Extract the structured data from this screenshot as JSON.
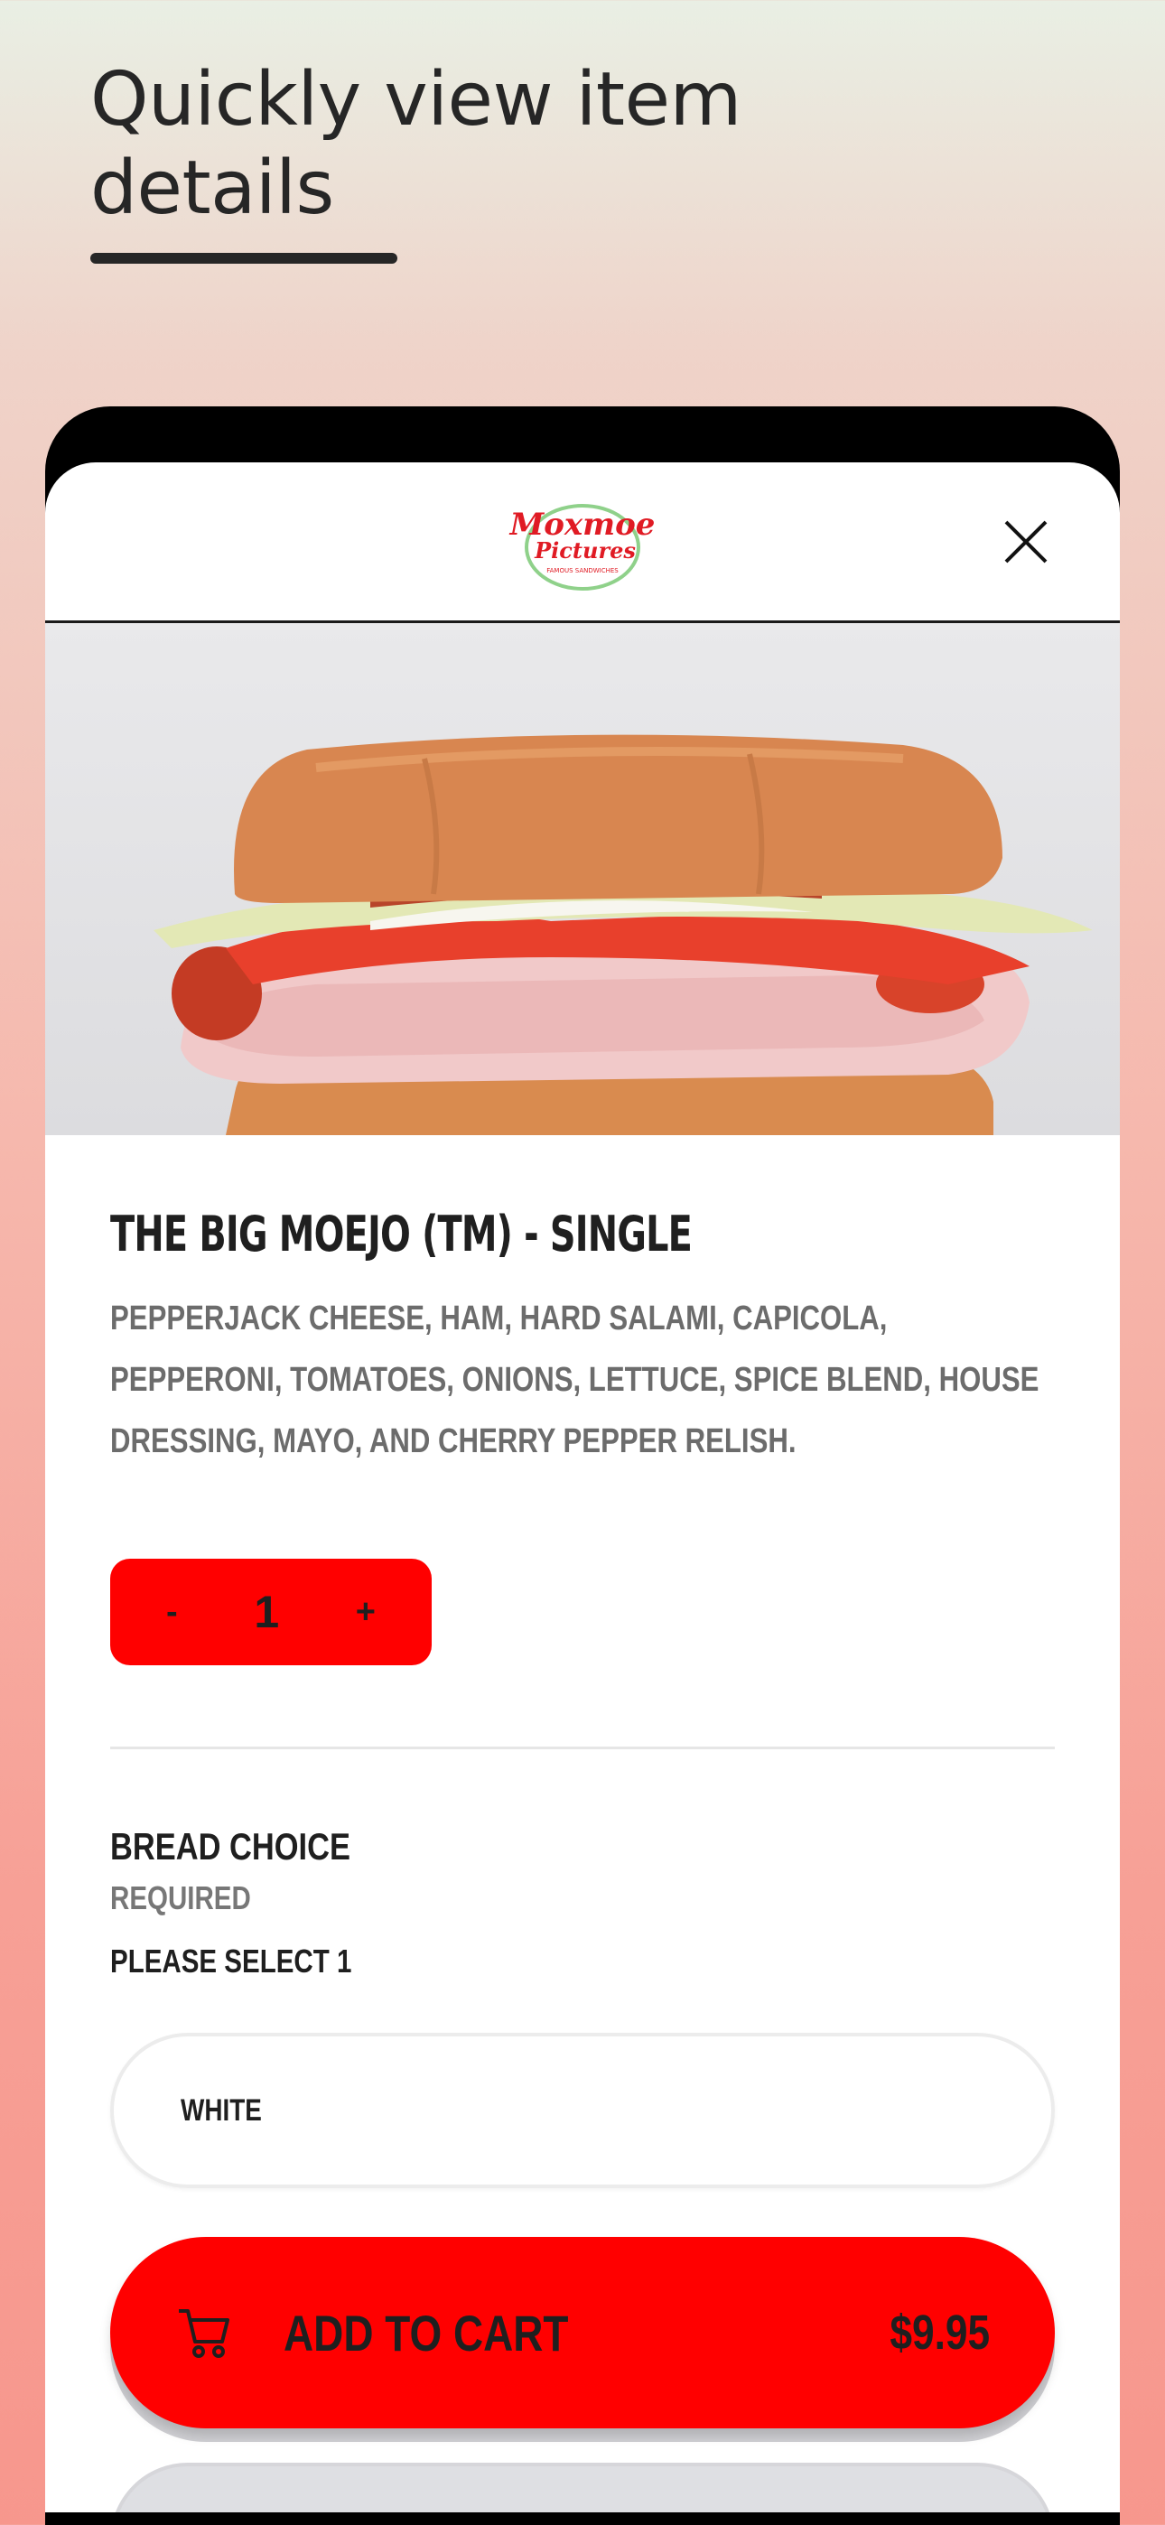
{
  "headline": "Quickly view item details",
  "brand": {
    "line1": "Moxmoe",
    "line2": "Pictures",
    "tagline": "FAMOUS SANDWICHES",
    "color": "#e01b24"
  },
  "header": {
    "close_icon": "close-icon"
  },
  "item": {
    "title": "THE BIG MOEJO (TM) - SINGLE",
    "description": "PEPPERJACK CHEESE, HAM, HARD SALAMI, CAPICOLA, PEPPERONI, TOMATOES, ONIONS, LETTUCE, SPICE BLEND, HOUSE DRESSING, MAYO, AND CHERRY PEPPER RELISH."
  },
  "stepper": {
    "minus": "-",
    "quantity": "1",
    "plus": "+"
  },
  "option_group": {
    "title": "BREAD CHOICE",
    "required": "REQUIRED",
    "instruction": "PLEASE SELECT 1",
    "options": [
      "WHITE"
    ]
  },
  "cart": {
    "label": "ADD TO CART",
    "price": "$9.95",
    "icon": "cart-icon"
  },
  "colors": {
    "accent": "#ff0000",
    "text": "#1f1f1f"
  }
}
